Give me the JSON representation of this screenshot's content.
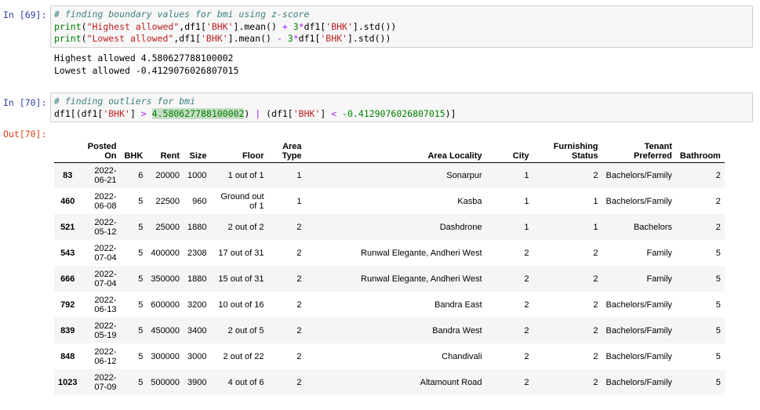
{
  "cells": [
    {
      "in_prompt": "In [69]:",
      "code_lines": [
        "# finding boundary values for bmi using z-score",
        "print(\"Highest allowed\",df1['BHK'].mean() + 3*df1['BHK'].std())",
        "print(\"Lowest allowed\",df1['BHK'].mean() - 3*df1['BHK'].std())"
      ],
      "output_lines": [
        "Highest allowed 4.580627788100002",
        "Lowest allowed -0.4129076026807015"
      ]
    },
    {
      "in_prompt": "In [70]:",
      "out_prompt": "Out[70]:",
      "code_lines": [
        "# finding outliers for bmi",
        "df1[(df1['BHK'] > 4.580627788100002) | (df1['BHK'] < -0.4129076026807015)]"
      ]
    }
  ],
  "table": {
    "columns": [
      "",
      "Posted On",
      "BHK",
      "Rent",
      "Size",
      "Floor",
      "Area Type",
      "Area Locality",
      "City",
      "Furnishing Status",
      "Tenant Preferred",
      "Bathroom"
    ],
    "rows": [
      [
        "83",
        "2022-06-21",
        "6",
        "20000",
        "1000",
        "1 out of 1",
        "1",
        "Sonarpur",
        "1",
        "2",
        "Bachelors/Family",
        "2"
      ],
      [
        "460",
        "2022-06-08",
        "5",
        "22500",
        "960",
        "Ground out of 1",
        "1",
        "Kasba",
        "1",
        "1",
        "Bachelors/Family",
        "2"
      ],
      [
        "521",
        "2022-05-12",
        "5",
        "25000",
        "1880",
        "2 out of 2",
        "2",
        "Dashdrone",
        "1",
        "1",
        "Bachelors",
        "2"
      ],
      [
        "543",
        "2022-07-04",
        "5",
        "400000",
        "2308",
        "17 out of 31",
        "2",
        "Runwal Elegante, Andheri West",
        "2",
        "2",
        "Family",
        "5"
      ],
      [
        "666",
        "2022-07-04",
        "5",
        "350000",
        "1880",
        "15 out of 31",
        "2",
        "Runwal Elegante, Andheri West",
        "2",
        "2",
        "Family",
        "5"
      ],
      [
        "792",
        "2022-06-13",
        "5",
        "600000",
        "3200",
        "10 out of 16",
        "2",
        "Bandra East",
        "2",
        "2",
        "Bachelors/Family",
        "5"
      ],
      [
        "839",
        "2022-05-19",
        "5",
        "450000",
        "3400",
        "2 out of 5",
        "2",
        "Bandra West",
        "2",
        "2",
        "Bachelors/Family",
        "5"
      ],
      [
        "848",
        "2022-06-12",
        "5",
        "300000",
        "3000",
        "2 out of 22",
        "2",
        "Chandivali",
        "2",
        "2",
        "Bachelors/Family",
        "5"
      ],
      [
        "1023",
        "2022-07-09",
        "5",
        "500000",
        "3900",
        "4 out of 6",
        "2",
        "Altamount Road",
        "2",
        "2",
        "Bachelors/Family",
        "5"
      ]
    ]
  }
}
